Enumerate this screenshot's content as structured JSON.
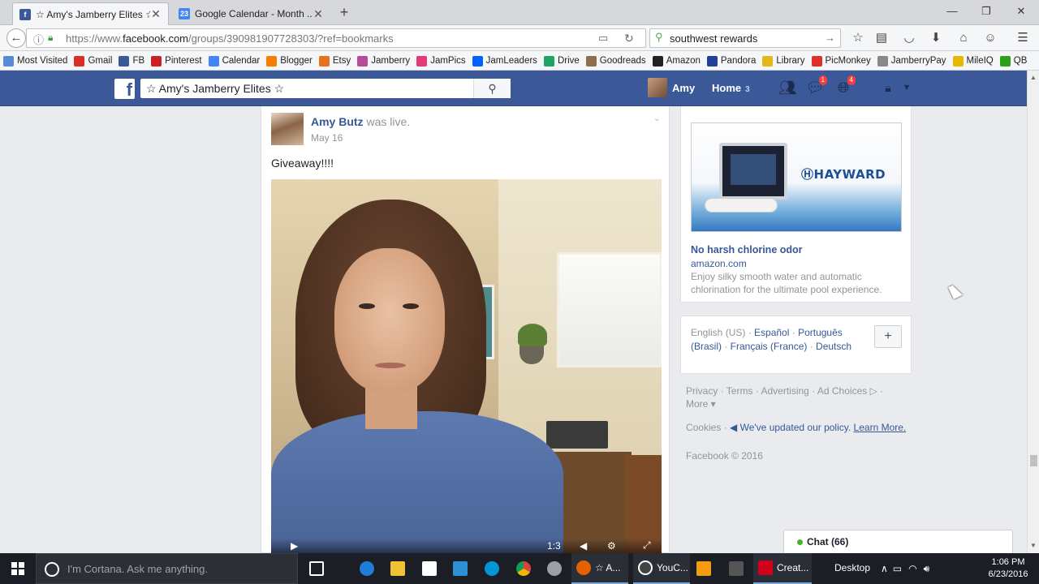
{
  "browser": {
    "tabs": [
      {
        "label": "☆ Amy's Jamberry Elites ☆",
        "active": true
      },
      {
        "label": "Google Calendar - Month ...",
        "active": false
      }
    ],
    "url_prefix": "https://www.",
    "url_domain": "facebook.com",
    "url_path": "/groups/390981907728303/?ref=bookmarks",
    "search_value": "southwest rewards",
    "bookmarks": [
      {
        "label": "Most Visited",
        "color": "#5a8ad6"
      },
      {
        "label": "Gmail",
        "color": "#d93025"
      },
      {
        "label": "FB",
        "color": "#3b5998"
      },
      {
        "label": "Pinterest",
        "color": "#cb2027"
      },
      {
        "label": "Calendar",
        "color": "#4285f4"
      },
      {
        "label": "Blogger",
        "color": "#f57d00"
      },
      {
        "label": "Etsy",
        "color": "#e8711f"
      },
      {
        "label": "Jamberry",
        "color": "#b84a9a"
      },
      {
        "label": "JamPics",
        "color": "#e23a7a"
      },
      {
        "label": "JamLeaders",
        "color": "#0061ff"
      },
      {
        "label": "Drive",
        "color": "#1fa463"
      },
      {
        "label": "Goodreads",
        "color": "#8d6e4f"
      },
      {
        "label": "Amazon",
        "color": "#222222"
      },
      {
        "label": "Pandora",
        "color": "#224099"
      },
      {
        "label": "Library",
        "color": "#e4b61a"
      },
      {
        "label": "PicMonkey",
        "color": "#e0302a"
      },
      {
        "label": "JamberryPay",
        "color": "#888888"
      },
      {
        "label": "MileIQ",
        "color": "#e6b800"
      },
      {
        "label": "QB",
        "color": "#2ca01c"
      }
    ]
  },
  "facebook": {
    "search_value": "☆ Amy's Jamberry Elites ☆",
    "user_name": "Amy",
    "home_label": "Home",
    "home_count": "3",
    "messages_badge": "1",
    "notifications_badge": "4",
    "brand_color": "#3b5998"
  },
  "post": {
    "author": "Amy Butz",
    "action": "was live.",
    "date": "May 16",
    "text": "Giveaway!!!!",
    "video_time": "1:3"
  },
  "ad": {
    "brand": "HAYWARD",
    "title": "No harsh chlorine odor",
    "domain": "amazon.com",
    "body": "Enjoy silky smooth water and automatic chlorination for the ultimate pool experience."
  },
  "languages": {
    "current": "English (US)",
    "others": [
      "Español",
      "Português (Brasil)",
      "Français (France)",
      "Deutsch"
    ],
    "add_label": "+"
  },
  "footer": {
    "links": [
      "Privacy",
      "Terms",
      "Advertising",
      "Ad Choices",
      "More"
    ],
    "cookies": "Cookies",
    "policy_notice": "We've updated our policy.",
    "learn_more": "Learn More.",
    "copyright": "Facebook © 2016"
  },
  "chat": {
    "label": "Chat (66)"
  },
  "taskbar": {
    "cortana_placeholder": "I'm Cortana. Ask me anything.",
    "apps": [
      {
        "label": "☆ A...",
        "color": "#e66000"
      },
      {
        "label": "YouC...",
        "color": "#555555"
      },
      {
        "label": "Creat...",
        "color": "#d0021b"
      }
    ],
    "desktop_label": "Desktop",
    "time": "1:06 PM",
    "date": "6/23/2016"
  }
}
